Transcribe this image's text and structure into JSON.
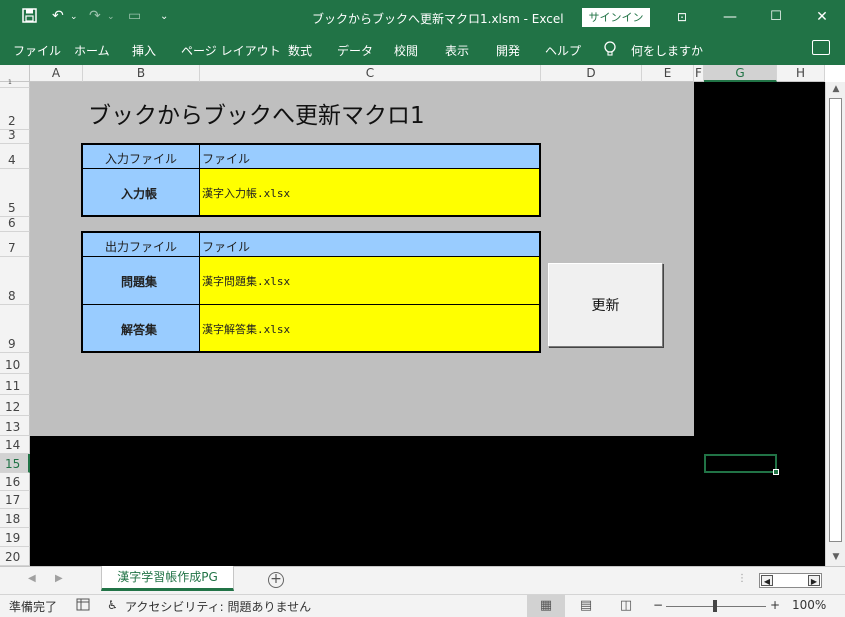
{
  "window": {
    "title": "ブックからブックへ更新マクロ1.xlsm  -  Excel",
    "signin_label": "サインイン",
    "colors": {
      "accent": "#217346",
      "header_blue": "#99ccff",
      "value_yellow": "#ffff00",
      "sheet_gray": "#bfbfbf"
    }
  },
  "quick_access": {
    "save_icon": "save-icon",
    "undo_icon": "undo-icon",
    "redo_icon": "redo-icon",
    "customize_icon": "chevron-down-icon"
  },
  "ribbon": {
    "tabs": [
      "ファイル",
      "ホーム",
      "挿入",
      "ページ レイアウト",
      "数式",
      "データ",
      "校閲",
      "表示",
      "開発",
      "ヘルプ"
    ],
    "tell_me": "何をしますか"
  },
  "grid": {
    "columns": [
      "A",
      "B",
      "C",
      "D",
      "E",
      "F",
      "G",
      "H"
    ],
    "rows": [
      "1",
      "2",
      "3",
      "4",
      "5",
      "6",
      "7",
      "8",
      "9",
      "10",
      "11",
      "12",
      "13",
      "14",
      "15",
      "16",
      "17",
      "18",
      "19",
      "20"
    ],
    "selected_column": "G",
    "selected_row": "15"
  },
  "sheet": {
    "title": "ブックからブックへ更新マクロ1",
    "input_table": {
      "header_label": "入力ファイル",
      "header_value": "ファイル",
      "rows": [
        {
          "label": "入力帳",
          "value": "漢字入力帳.xlsx"
        }
      ]
    },
    "output_table": {
      "header_label": "出力ファイル",
      "header_value": "ファイル",
      "rows": [
        {
          "label": "問題集",
          "value": "漢字問題集.xlsx"
        },
        {
          "label": "解答集",
          "value": "漢字解答集.xlsx"
        }
      ]
    },
    "update_button": "更新"
  },
  "sheet_tabs": {
    "active": "漢字学習帳作成PG",
    "add_icon": "plus-icon"
  },
  "status": {
    "ready": "準備完了",
    "accessibility": "アクセシビリティ: 問題ありません",
    "zoom": "100%",
    "zoom_minus": "−",
    "zoom_plus": "+"
  }
}
